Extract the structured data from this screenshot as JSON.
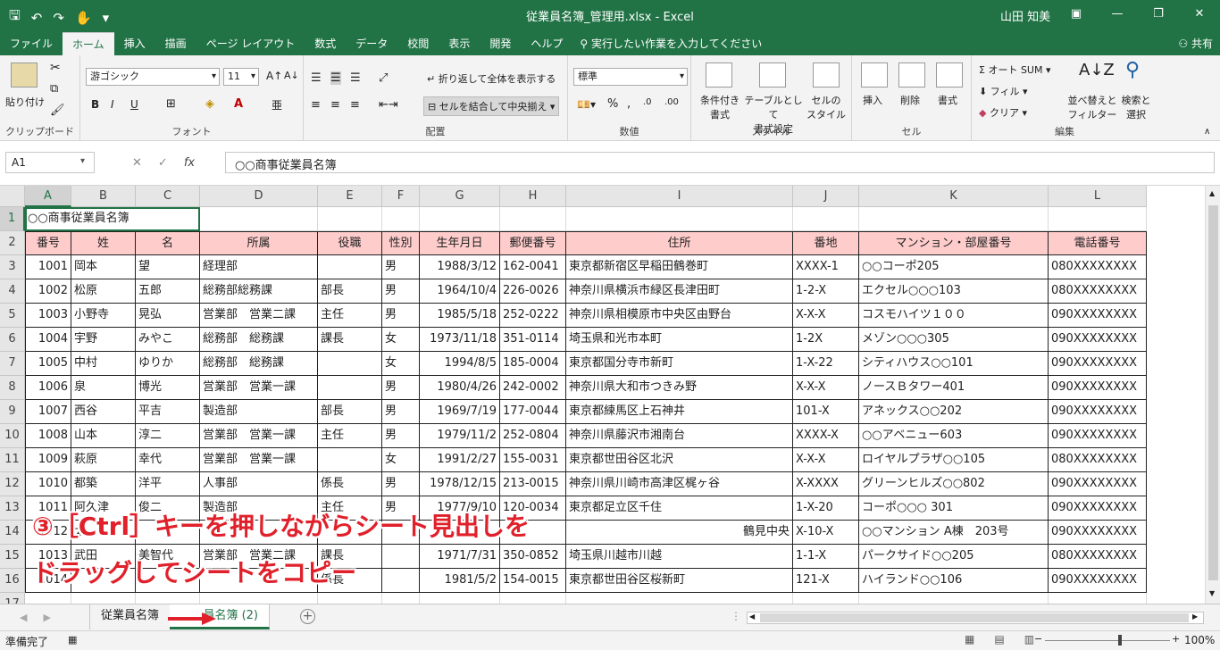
{
  "titlebar": {
    "title": "従業員名簿_管理用.xlsx  -  Excel",
    "user": "山田 知美"
  },
  "menu_tabs": [
    {
      "label": "ファイル"
    },
    {
      "label": "ホーム",
      "active": true
    },
    {
      "label": "挿入"
    },
    {
      "label": "描画"
    },
    {
      "label": "ページ レイアウト"
    },
    {
      "label": "数式"
    },
    {
      "label": "データ"
    },
    {
      "label": "校閲"
    },
    {
      "label": "表示"
    },
    {
      "label": "開発"
    },
    {
      "label": "ヘルプ"
    }
  ],
  "tell_me": "実行したい作業を入力してください",
  "share": "共有",
  "ribbon": {
    "clipboard": {
      "paste": "貼り付け",
      "group": "クリップボード"
    },
    "font": {
      "name": "游ゴシック",
      "size": "11",
      "bold": "B",
      "italic": "I",
      "underline": "U",
      "group": "フォント"
    },
    "align": {
      "wrap": "折り返して全体を表示する",
      "merge": "セルを結合して中央揃え",
      "group": "配置"
    },
    "number": {
      "format": "標準",
      "percent": "%",
      "group": "数値"
    },
    "styles": {
      "cond": "条件付き\n書式",
      "table": "テーブルとして\n書式設定",
      "cell": "セルの\nスタイル",
      "group": "スタイル"
    },
    "cells": {
      "insert": "挿入",
      "delete": "削除",
      "format": "書式",
      "group": "セル"
    },
    "edit": {
      "autosum": "オート SUM",
      "fill": "フィル",
      "clear": "クリア",
      "sort": "並べ替えと\nフィルター",
      "find": "検索と\n選択",
      "group": "編集"
    }
  },
  "formula_bar": {
    "namebox": "A1",
    "content": "○○商事従業員名簿"
  },
  "columns": [
    {
      "label": "A"
    },
    {
      "label": "B"
    },
    {
      "label": "C"
    },
    {
      "label": "D"
    },
    {
      "label": "E"
    },
    {
      "label": "F"
    },
    {
      "label": "G"
    },
    {
      "label": "H"
    },
    {
      "label": "I"
    },
    {
      "label": "J"
    },
    {
      "label": "K"
    },
    {
      "label": "L"
    }
  ],
  "title_cell": "○○商事従業員名簿",
  "headers": [
    "番号",
    "姓",
    "名",
    "所属",
    "役職",
    "性別",
    "生年月日",
    "郵便番号",
    "住所",
    "番地",
    "マンション・部屋番号",
    "電話番号"
  ],
  "rows": [
    [
      "1001",
      "岡本",
      "望",
      "経理部",
      "",
      "男",
      "1988/3/12",
      "162-0041",
      "東京都新宿区早稲田鶴巻町",
      "XXXX-1",
      "○○コーポ205",
      "080XXXXXXXX"
    ],
    [
      "1002",
      "松原",
      "五郎",
      "総務部総務課",
      "部長",
      "男",
      "1964/10/4",
      "226-0026",
      "神奈川県横浜市緑区長津田町",
      "1-2-X",
      "エクセル○○○103",
      "080XXXXXXXX"
    ],
    [
      "1003",
      "小野寺",
      "晃弘",
      "営業部　営業二課",
      "主任",
      "男",
      "1985/5/18",
      "252-0222",
      "神奈川県相模原市中央区由野台",
      "X-X-X",
      "コスモハイツ１００",
      "090XXXXXXXX"
    ],
    [
      "1004",
      "宇野",
      "みやこ",
      "総務部　総務課",
      "課長",
      "女",
      "1973/11/18",
      "351-0114",
      "埼玉県和光市本町",
      "1-2X",
      "メゾン○○○305",
      "090XXXXXXXX"
    ],
    [
      "1005",
      "中村",
      "ゆりか",
      "総務部　総務課",
      "",
      "女",
      "1994/8/5",
      "185-0004",
      "東京都国分寺市新町",
      "1-X-22",
      "シティハウス○○101",
      "090XXXXXXXX"
    ],
    [
      "1006",
      "泉",
      "博光",
      "営業部　営業一課",
      "",
      "男",
      "1980/4/26",
      "242-0002",
      "神奈川県大和市つきみ野",
      "X-X-X",
      "ノースＢタワー401",
      "090XXXXXXXX"
    ],
    [
      "1007",
      "西谷",
      "平吉",
      "製造部",
      "部長",
      "男",
      "1969/7/19",
      "177-0044",
      "東京都練馬区上石神井",
      "101-X",
      "アネックス○○202",
      "090XXXXXXXX"
    ],
    [
      "1008",
      "山本",
      "淳二",
      "営業部　営業一課",
      "主任",
      "男",
      "1979/11/2",
      "252-0804",
      "神奈川県藤沢市湘南台",
      "XXXX-X",
      "○○アベニュー603",
      "090XXXXXXXX"
    ],
    [
      "1009",
      "萩原",
      "幸代",
      "営業部　営業一課",
      "",
      "女",
      "1991/2/27",
      "155-0031",
      "東京都世田谷区北沢",
      "X-X-X",
      "ロイヤルプラザ○○105",
      "080XXXXXXXX"
    ],
    [
      "1010",
      "都築",
      "洋平",
      "人事部",
      "係長",
      "男",
      "1978/12/15",
      "213-0015",
      "神奈川県川崎市高津区梶ヶ谷",
      "X-XXXX",
      "グリーンヒルズ○○802",
      "090XXXXXXXX"
    ],
    [
      "1011",
      "阿久津",
      "俊二",
      "製造部",
      "主任",
      "男",
      "1977/9/10",
      "120-0034",
      "東京都足立区千住",
      "1-X-20",
      "コーポ○○○ 301",
      "090XXXXXXXX"
    ],
    [
      "1012",
      "太",
      "",
      "",
      "",
      "",
      "",
      "",
      "",
      "X-10-X",
      "○○マンション A棟　203号",
      "090XXXXXXXX"
    ],
    [
      "1013",
      "武田",
      "美智代",
      "営業部　営業二課",
      "課長",
      "",
      "1971/7/31",
      "350-0852",
      "埼玉県川越市川越",
      "1-1-X",
      "パークサイド○○205",
      "080XXXXXXXX"
    ],
    [
      "1014",
      "",
      "",
      "",
      "係長",
      "",
      "1981/5/2",
      "154-0015",
      "東京都世田谷区桜新町",
      "121-X",
      "ハイランド○○106",
      "090XXXXXXXX"
    ]
  ],
  "row14_address_partial": "鶴見中央",
  "row_numbers": [
    "1",
    "2",
    "3",
    "4",
    "5",
    "6",
    "7",
    "8",
    "9",
    "10",
    "11",
    "12",
    "13",
    "14",
    "15",
    "16",
    "17"
  ],
  "annotation": {
    "line1": "③［Ctrl］キーを押しながらシート見出しを",
    "line2": "ドラッグしてシートをコピー"
  },
  "sheets": [
    {
      "label": "従業員名簿"
    },
    {
      "label": "員名簿 (2)",
      "active": true
    }
  ],
  "status": {
    "ready": "準備完了",
    "zoom": "100%"
  },
  "colors": {
    "accent": "#217346",
    "header_fill": "#ffcccc",
    "annotation": "#e0202a"
  }
}
